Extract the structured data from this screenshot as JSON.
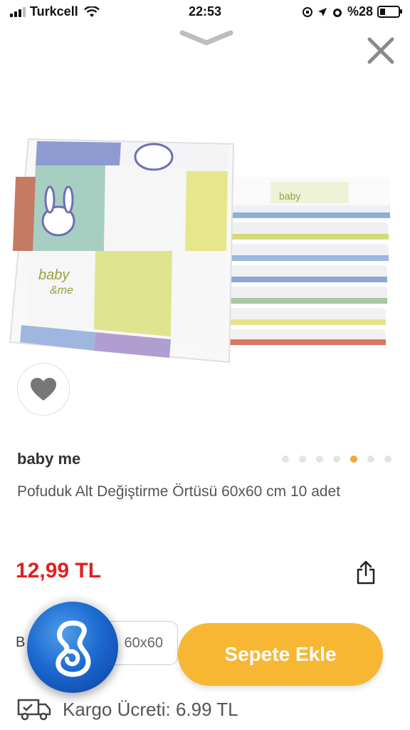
{
  "status_bar": {
    "carrier": "Turkcell",
    "time": "22:53",
    "battery": "%28",
    "battery_level": 0.28
  },
  "product": {
    "brand": "baby me",
    "title": "Pofuduk Alt Değiştirme Örtüsü 60x60 cm 10 adet",
    "price": "12,99 TL",
    "size_label_partial": "B",
    "size_value": "60x60",
    "image_index": 5,
    "image_count": 7,
    "image_print": {
      "brand_line1": "baby",
      "brand_line2": "&me"
    }
  },
  "actions": {
    "add_to_cart": "Sepete Ekle"
  },
  "shipping": {
    "label": "Kargo Ücreti: 6.99 TL"
  },
  "colors": {
    "accent": "#f7b733",
    "price": "#e1211f",
    "dot_active": "#f0a83a",
    "dot_inactive": "#e4e4e4"
  },
  "icons": [
    "chevron-down-icon",
    "close-icon",
    "heart-icon",
    "share-icon",
    "truck-icon",
    "chat-support-icon",
    "signal-icon",
    "wifi-icon",
    "battery-icon",
    "alarm-icon",
    "location-icon",
    "lock-rotation-icon"
  ]
}
